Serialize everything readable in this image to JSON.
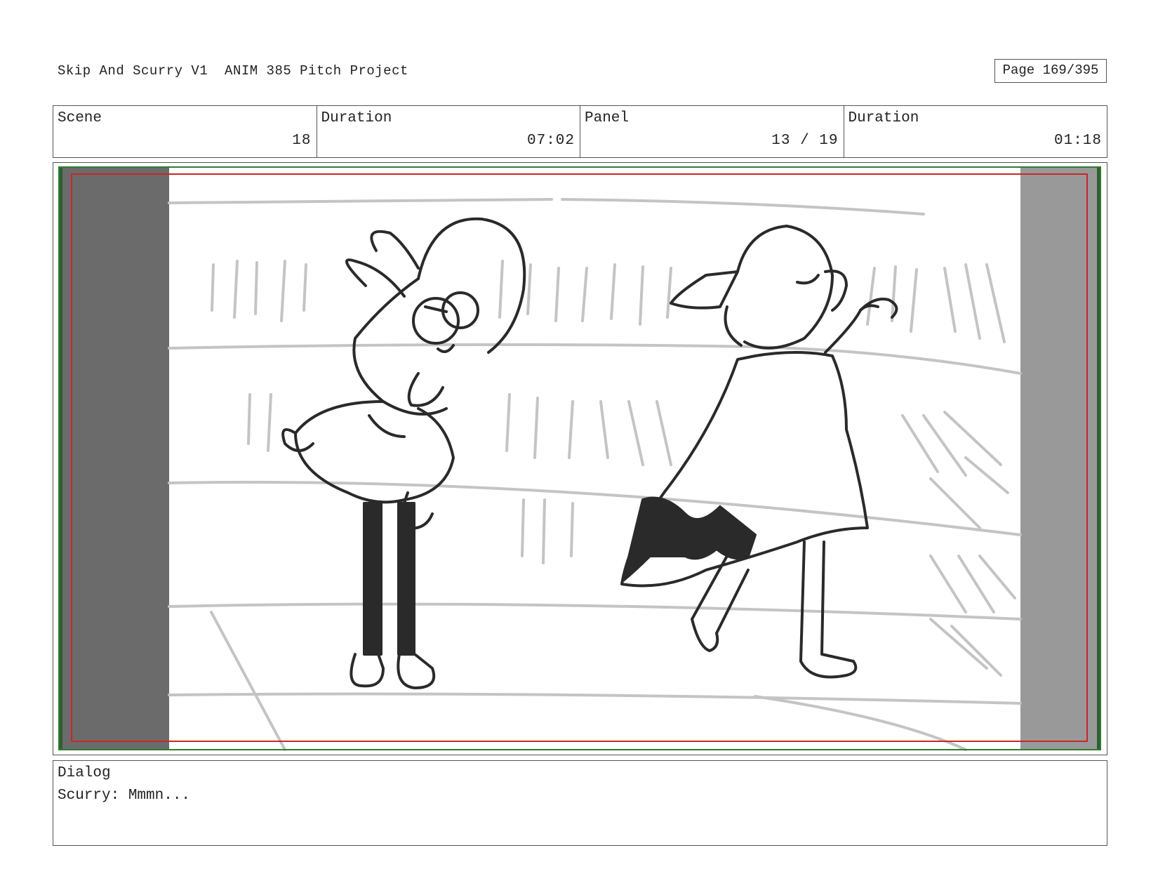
{
  "header": {
    "title": "Skip And Scurry V1  ANIM 385 Pitch Project",
    "page": "Page 169/395"
  },
  "info": {
    "scene_label": "Scene",
    "scene_value": "18",
    "duration_label": "Duration",
    "duration_value": "07:02",
    "panel_label": "Panel",
    "panel_value": "13 / 19",
    "panel_duration_label": "Duration",
    "panel_duration_value": "01:18"
  },
  "dialog": {
    "label": "Dialog",
    "text": "Scurry: Mmmn..."
  },
  "colors": {
    "border": "#555555",
    "left_bar": "#6b6b6b",
    "right_bar": "#999999",
    "safe_frame_green": "#2e7d32",
    "safe_frame_red": "#c62828"
  }
}
